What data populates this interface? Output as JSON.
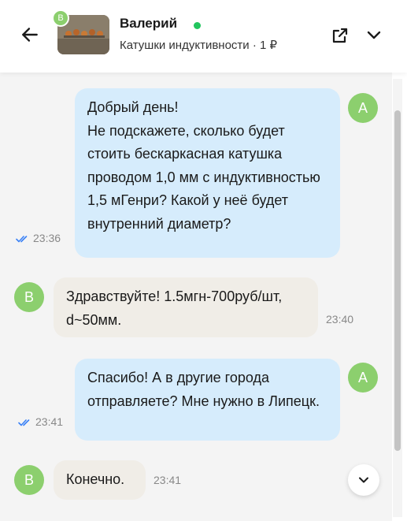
{
  "header": {
    "contact_name": "Валерий",
    "contact_initial": "В",
    "listing_title": "Катушки индуктивности · 1 ₽"
  },
  "messages": [
    {
      "direction": "out",
      "avatar": "А",
      "text": "Добрый день!\nНе подскажете, сколько будет стоить бескаркасная катушка проводом 1,0 мм с индуктивностью 1,5 мГенри? Какой у неё будет внутренний диаметр?",
      "time": "23:36",
      "read": true
    },
    {
      "direction": "in",
      "avatar": "В",
      "text": "Здравствуйте! 1.5мгн-700руб/шт, d~50мм.",
      "time": "23:40"
    },
    {
      "direction": "out",
      "avatar": "А",
      "text": "Спасибо! А в другие города отправляете? Мне нужно в Липецк.",
      "time": "23:41",
      "read": true
    },
    {
      "direction": "in",
      "avatar": "В",
      "text": "Конечно.",
      "time": "23:41"
    }
  ],
  "colors": {
    "outgoing_bubble": "#d6ecfc",
    "incoming_bubble": "#f0ede7",
    "avatar": "#8ccf6e",
    "online": "#22c55e",
    "read_check": "#3b82f6"
  },
  "icons": [
    "back-arrow-icon",
    "open-external-icon",
    "chevron-down-icon",
    "double-check-icon",
    "scroll-down-icon"
  ]
}
